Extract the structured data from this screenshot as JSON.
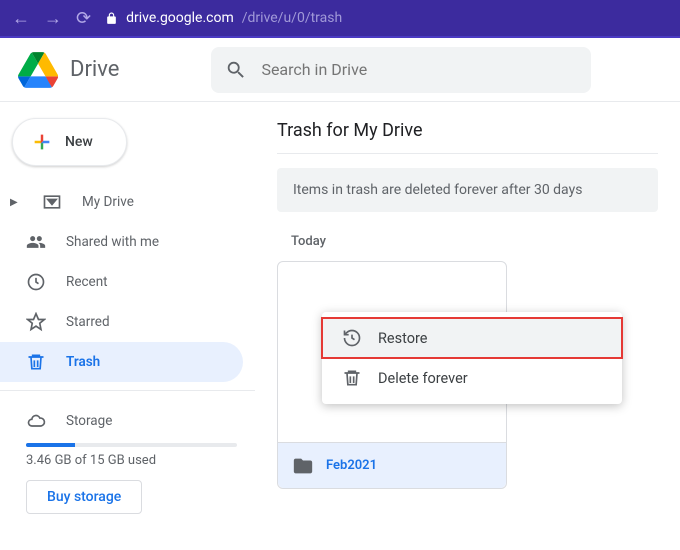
{
  "browser": {
    "url_host": "drive.google.com",
    "url_path": "/drive/u/0/trash"
  },
  "app": {
    "title": "Drive",
    "search_placeholder": "Search in Drive"
  },
  "sidebar": {
    "new_label": "New",
    "items": [
      {
        "label": "My Drive"
      },
      {
        "label": "Shared with me"
      },
      {
        "label": "Recent"
      },
      {
        "label": "Starred"
      },
      {
        "label": "Trash"
      }
    ],
    "storage_label": "Storage",
    "storage_used_text": "3.46 GB of 15 GB used",
    "buy_label": "Buy storage"
  },
  "main": {
    "title": "Trash for My Drive",
    "notice": "Items in trash are deleted forever after 30 days",
    "section_label": "Today",
    "file_name": "Feb2021"
  },
  "context_menu": {
    "restore": "Restore",
    "delete": "Delete forever"
  }
}
